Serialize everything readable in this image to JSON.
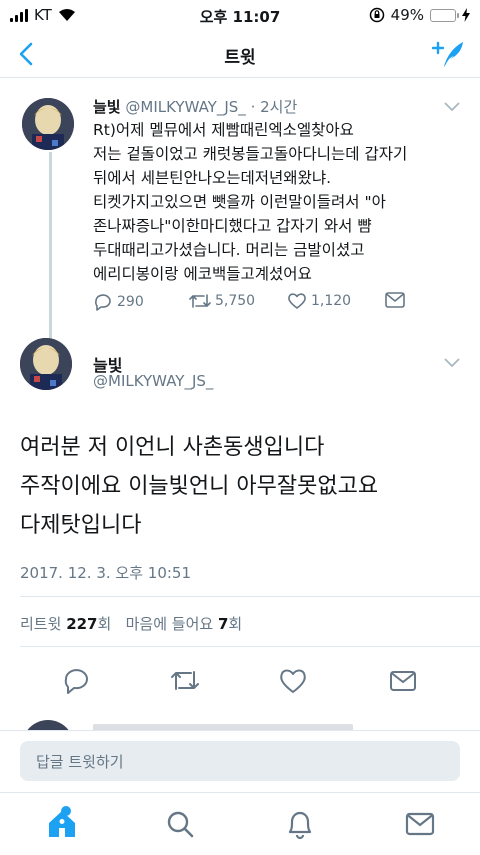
{
  "status_bar": {
    "carrier": "KT",
    "time": "오후 11:07",
    "battery": "49%",
    "battery_level": 0.49
  },
  "nav": {
    "title": "트윗"
  },
  "parent_tweet": {
    "name": "늘빛",
    "handle": "@MILKYWAY_JS_",
    "dot": "·",
    "time": "2시간",
    "lines": [
      "Rt)어제 멜뮤에서 제빰때린엑소엘찾아요",
      "저는 겉돌이었고 캐럿봉들고돌아다니는데 갑자기",
      "뒤에서 세븐틴안나오는데저년왜왔냐.",
      "티켓가지고있으면 뺏을까 이런말이들려서 \"아",
      "존나짜증나\"이한마디했다고 갑자기 와서 뺨",
      "두대때리고가셨습니다. 머리는 금발이셨고",
      "에리디봉이랑 에코백들고계셨어요"
    ],
    "replies": "290",
    "retweets": "5,750",
    "likes": "1,120"
  },
  "main_tweet": {
    "name": "늘빛",
    "handle": "@MILKYWAY_JS_",
    "lines": [
      "여러분 저 이언니 사촌동생입니다",
      "주작이에요 이늘빛언니 아무잘못없고요",
      "다제탓입니다"
    ],
    "timestamp": "2017. 12. 3. 오후 10:51",
    "retweet_label": "리트윗",
    "retweet_count": "227",
    "retweet_unit": "회",
    "like_label": "마음에 들어요",
    "like_count": "7",
    "like_unit": "회"
  },
  "reply_bar": {
    "placeholder": "답글 트윗하기"
  },
  "colors": {
    "accent": "#1da1f2",
    "text": "#14171a",
    "muted": "#657786",
    "border": "#e1e8ed"
  },
  "icons": {
    "nav": [
      "back-arrow-icon",
      "compose-tweet-icon"
    ],
    "tweet_actions": [
      "reply-icon",
      "retweet-icon",
      "like-icon",
      "direct-message-icon"
    ],
    "tabs": [
      "home-icon",
      "search-icon",
      "notifications-icon",
      "messages-icon"
    ]
  }
}
